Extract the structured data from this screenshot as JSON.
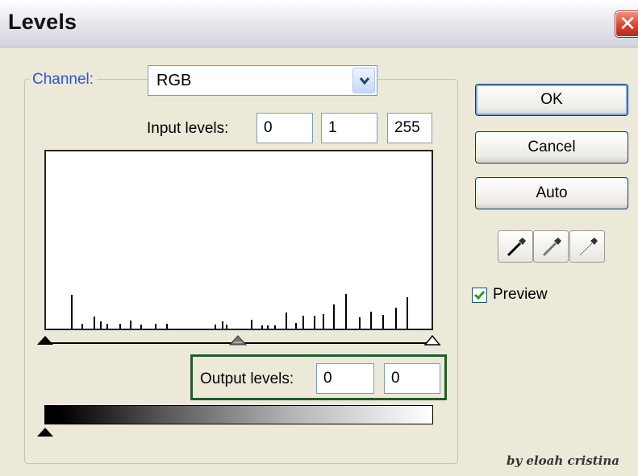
{
  "window": {
    "title": "Levels",
    "close_icon": "close-icon"
  },
  "channel": {
    "label": "Channel:",
    "value": "RGB"
  },
  "input_levels": {
    "label": "Input levels:",
    "black": "0",
    "gamma": "1",
    "white": "255"
  },
  "output_levels": {
    "label": "Output levels:",
    "black": "0",
    "white": "0"
  },
  "buttons": {
    "ok": "OK",
    "cancel": "Cancel",
    "auto": "Auto"
  },
  "eyedroppers": [
    "black-point-eyedropper-icon",
    "gray-point-eyedropper-icon",
    "white-point-eyedropper-icon"
  ],
  "preview": {
    "label": "Preview",
    "checked": true
  },
  "credit": "by eloah cristina",
  "colors": {
    "accent_label": "#2a57d6",
    "highlight_box": "#1d5e26",
    "close_button": "#d8452d"
  }
}
